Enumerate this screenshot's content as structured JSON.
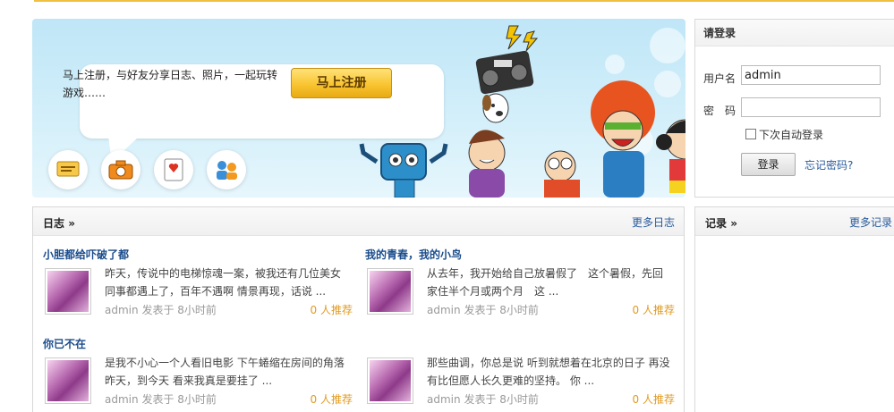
{
  "banner": {
    "intro_text": "马上注册，与好友分享日志、照片，一起玩转游戏……",
    "register_label": "马上注册",
    "features": [
      {
        "icon": "message-icon"
      },
      {
        "icon": "camera-icon"
      },
      {
        "icon": "card-icon"
      },
      {
        "icon": "friends-icon"
      }
    ]
  },
  "login": {
    "title": "请登录",
    "username_label": "用户名",
    "username_value": "admin",
    "password_label": "密　码",
    "password_value": "",
    "remember_label": "下次自动登录",
    "submit_label": "登录",
    "forgot_label": "忘记密码?"
  },
  "logs": {
    "title": "日志",
    "more_label": "更多日志",
    "entries": [
      {
        "title": "小胆都给吓破了都",
        "body": "昨天，传说中的电梯惊魂一案，被我还有几位美女同事都遇上了，百年不遇啊  情景再现，话说  ...",
        "author": "admin",
        "posted": "发表于",
        "time": "8小时前",
        "recommend": "0 人推荐"
      },
      {
        "title": "我的青春，我的小鸟",
        "body": " 从去年，我开始给自己放暑假了　这个暑假，先回家住半个月或两个月　这  ...",
        "author": "admin",
        "posted": "发表于",
        "time": "8小时前",
        "recommend": "0 人推荐"
      },
      {
        "title": "你已不在",
        "body": "是我不小心一个人看旧电影  下午蜷缩在房间的角落  昨天，到今天  看来我真是要挂了  ...",
        "author": "admin",
        "posted": "发表于",
        "time": "8小时前",
        "recommend": "0 人推荐"
      },
      {
        "title": "",
        "body": "那些曲调，你总是说  听到就想着在北京的日子  再没有比但愿人长久更难的坚持。  你  ...",
        "author": "admin",
        "posted": "发表于",
        "time": "8小时前",
        "recommend": "0 人推荐"
      }
    ]
  },
  "records": {
    "title": "记录",
    "more_label": "更多记录"
  },
  "colors": {
    "link": "#1a4c8c",
    "accent": "#e29a1f",
    "button_gold": "#f9c531"
  }
}
